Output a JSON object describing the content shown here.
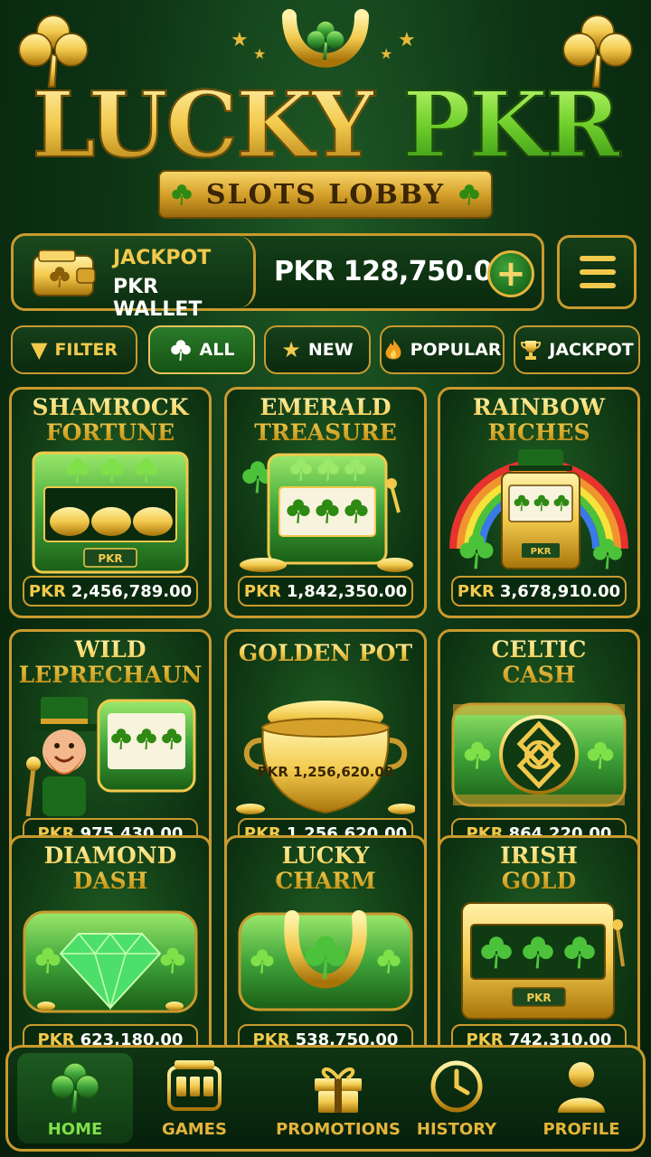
{
  "header": {
    "logo_word1": "LUCKY",
    "logo_word2": "PKR",
    "subtitle": "SLOTS LOBBY"
  },
  "wallet": {
    "label_line1": "JACKPOT",
    "label_line2": "PKR WALLET",
    "balance": "PKR 128,750.00",
    "add_icon": "plus-icon",
    "menu_icon": "hamburger-icon"
  },
  "filters": [
    {
      "label": "FILTER",
      "icon": "funnel-icon",
      "active": false
    },
    {
      "label": "ALL",
      "icon": "clover-icon",
      "active": true
    },
    {
      "label": "NEW",
      "icon": "star-icon",
      "active": false
    },
    {
      "label": "POPULAR",
      "icon": "flame-icon",
      "active": false
    },
    {
      "label": "JACKPOT",
      "icon": "trophy-icon",
      "active": false
    }
  ],
  "games": [
    {
      "title": "SHAMROCK\nFORTUNE",
      "currency": "PKR",
      "jackpot": "2,456,789.00",
      "art": "slot-machine-gold-pots",
      "machine_label": "PKR"
    },
    {
      "title": "EMERALD\nTREASURE",
      "currency": "PKR",
      "jackpot": "1,842,350.00",
      "art": "slot-machine-clovers"
    },
    {
      "title": "RAINBOW\nRICHES",
      "currency": "PKR",
      "jackpot": "3,678,910.00",
      "art": "slot-machine-rainbow",
      "machine_label": "PKR"
    },
    {
      "title": "WILD\nLEPRECHAUN",
      "currency": "PKR",
      "jackpot": "975,430.00",
      "art": "leprechaun-reels"
    },
    {
      "title": "GOLDEN POT",
      "currency": "PKR",
      "jackpot": "1,256,620.00",
      "art": "pot-of-gold",
      "pot_label": "PKR 1,256,620.00"
    },
    {
      "title": "CELTIC\nCASH",
      "currency": "PKR",
      "jackpot": "864,220.00",
      "art": "celtic-knot-reels"
    },
    {
      "title": "DIAMOND\nDASH",
      "currency": "PKR",
      "jackpot": "623,180.00",
      "art": "emerald-diamond-reels"
    },
    {
      "title": "LUCKY\nCHARM",
      "currency": "PKR",
      "jackpot": "538,750.00",
      "art": "horseshoe-reels"
    },
    {
      "title": "IRISH\nGOLD",
      "currency": "PKR",
      "jackpot": "742,310.00",
      "art": "gold-slot-machine",
      "machine_label": "PKR"
    }
  ],
  "nav": [
    {
      "label": "HOME",
      "icon": "clover-icon",
      "active": true
    },
    {
      "label": "GAMES",
      "icon": "slot-machine-icon",
      "active": false
    },
    {
      "label": "PROMOTIONS",
      "icon": "gift-icon",
      "active": false
    },
    {
      "label": "HISTORY",
      "icon": "clock-icon",
      "active": false
    },
    {
      "label": "PROFILE",
      "icon": "person-icon",
      "active": false
    }
  ],
  "colors": {
    "gold": "#f2c94c",
    "dark_green": "#0c3010",
    "bright_green": "#7fe04a"
  }
}
